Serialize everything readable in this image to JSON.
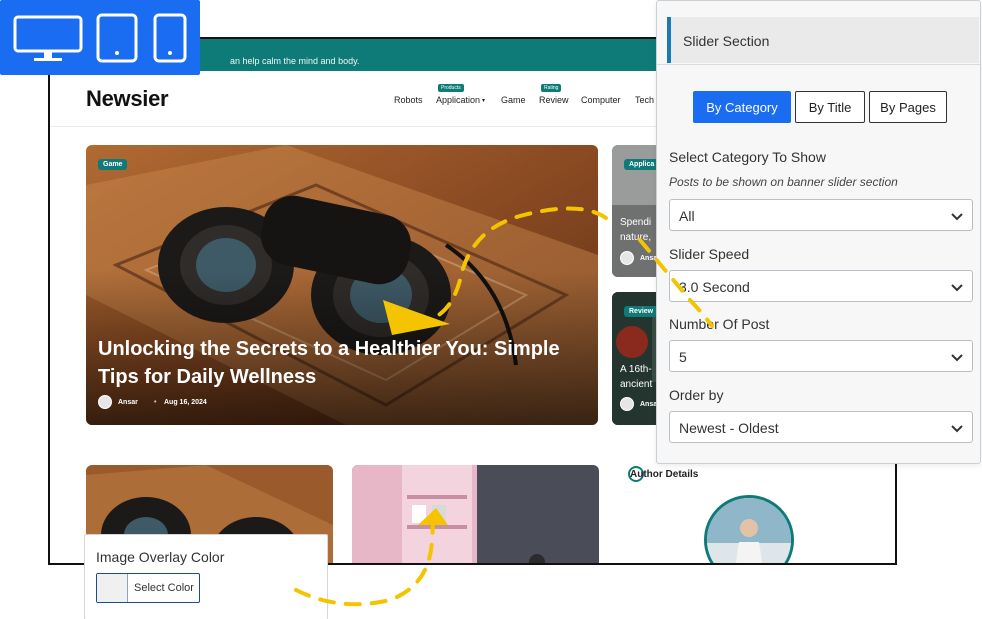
{
  "device_toggle": {
    "icons": [
      "desktop-icon",
      "tablet-icon",
      "mobile-icon"
    ]
  },
  "site": {
    "topbar_text": "an help calm the mind and body.",
    "brand": "Newsier",
    "nav": {
      "robots": "Robots",
      "application": "Application",
      "application_badge": "Products",
      "game": "Game",
      "review": "Review",
      "review_badge": "Rating",
      "computer": "Computer",
      "tech": "Tech"
    },
    "hero": {
      "tag": "Game",
      "title": "Unlocking the Secrets to a Healthier You: Simple Tips for Daily Wellness",
      "author": "Ansar",
      "date": "Aug 16, 2024"
    },
    "side_card_1": {
      "tag": "Applica",
      "text_line1": "Spendi",
      "text_line2": "nature,",
      "author": "Ansa"
    },
    "side_card_2": {
      "tag": "Review",
      "text_line1": "A 16th-",
      "text_line2": "ancient",
      "author": "Ansa"
    },
    "author_details": "Author Details"
  },
  "panel": {
    "title": "Slider Section",
    "tabs": [
      "By Category",
      "By Title",
      "By Pages"
    ],
    "active_tab": "By Category",
    "category_label": "Select Category To Show",
    "category_help": "Posts to be shown on banner slider section",
    "category_value": "All",
    "speed_label": "Slider Speed",
    "speed_value": "3.0 Second",
    "count_label": "Number Of Post",
    "count_value": "5",
    "order_label": "Order by",
    "order_value": "Newest - Oldest"
  },
  "overlay": {
    "title": "Image Overlay Color",
    "button_label": "Select Color"
  },
  "colors": {
    "accent_blue": "#1a6cf0",
    "teal": "#0f7b78",
    "highlight_yellow": "#f4c400"
  }
}
